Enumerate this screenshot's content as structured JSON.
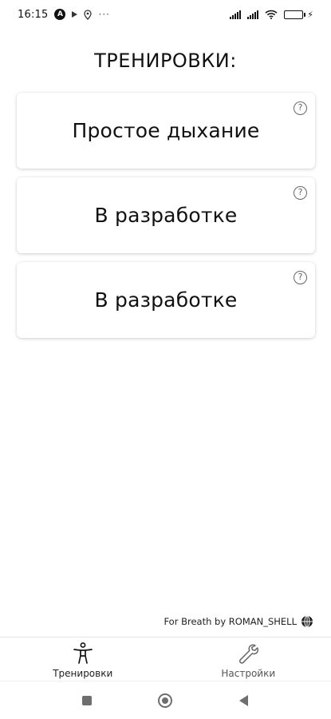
{
  "status_bar": {
    "time": "16:15",
    "app_badge": "A",
    "overflow": "···"
  },
  "title": "ТРЕНИРОВКИ:",
  "cards": [
    {
      "label": "Простое дыхание",
      "help": "?"
    },
    {
      "label": "В разработке",
      "help": "?"
    },
    {
      "label": "В разработке",
      "help": "?"
    }
  ],
  "credit": "For Breath by ROMAN_SHELL",
  "bottom_nav": {
    "items": [
      {
        "label": "Тренировки",
        "icon": "person-standing-icon"
      },
      {
        "label": "Настройки",
        "icon": "wrench-icon"
      }
    ]
  },
  "colors": {
    "battery_fill": "#2fc23f",
    "text": "#111111",
    "system_nav": "#6e6e6e"
  }
}
